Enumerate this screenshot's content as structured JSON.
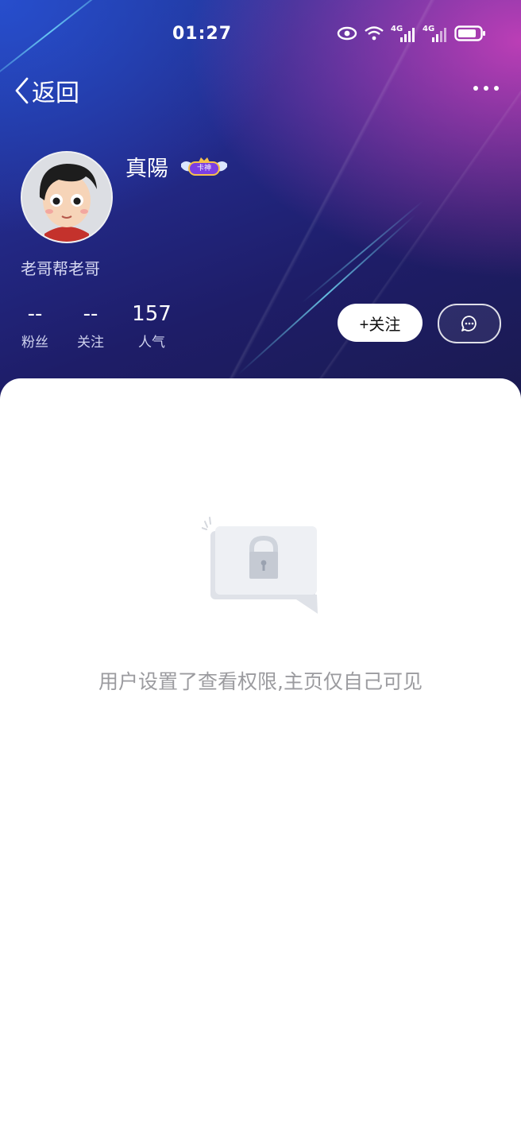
{
  "status_bar": {
    "time": "01:27",
    "icons": [
      "eye-icon",
      "wifi-icon",
      "signal-4g-icon",
      "signal-4g-icon",
      "battery-icon"
    ],
    "network_1": "4G",
    "network_2": "4G"
  },
  "nav": {
    "back_label": "返回",
    "more_icon": "more-dots-icon"
  },
  "profile": {
    "name": "真陽",
    "badge_text": "卡神",
    "signature": "老哥帮老哥",
    "stats": [
      {
        "value": "--",
        "label": "粉丝"
      },
      {
        "value": "--",
        "label": "关注"
      },
      {
        "value": "157",
        "label": "人气"
      }
    ],
    "follow_label": "+关注",
    "message_icon": "chat-bubble-icon"
  },
  "content": {
    "empty_icon": "locked-message-icon",
    "empty_text": "用户设置了查看权限,主页仅自己可见"
  },
  "colors": {
    "hero_primary": "#232a8a",
    "hero_accent": "#d642be",
    "empty_text": "#9b9b9f"
  }
}
